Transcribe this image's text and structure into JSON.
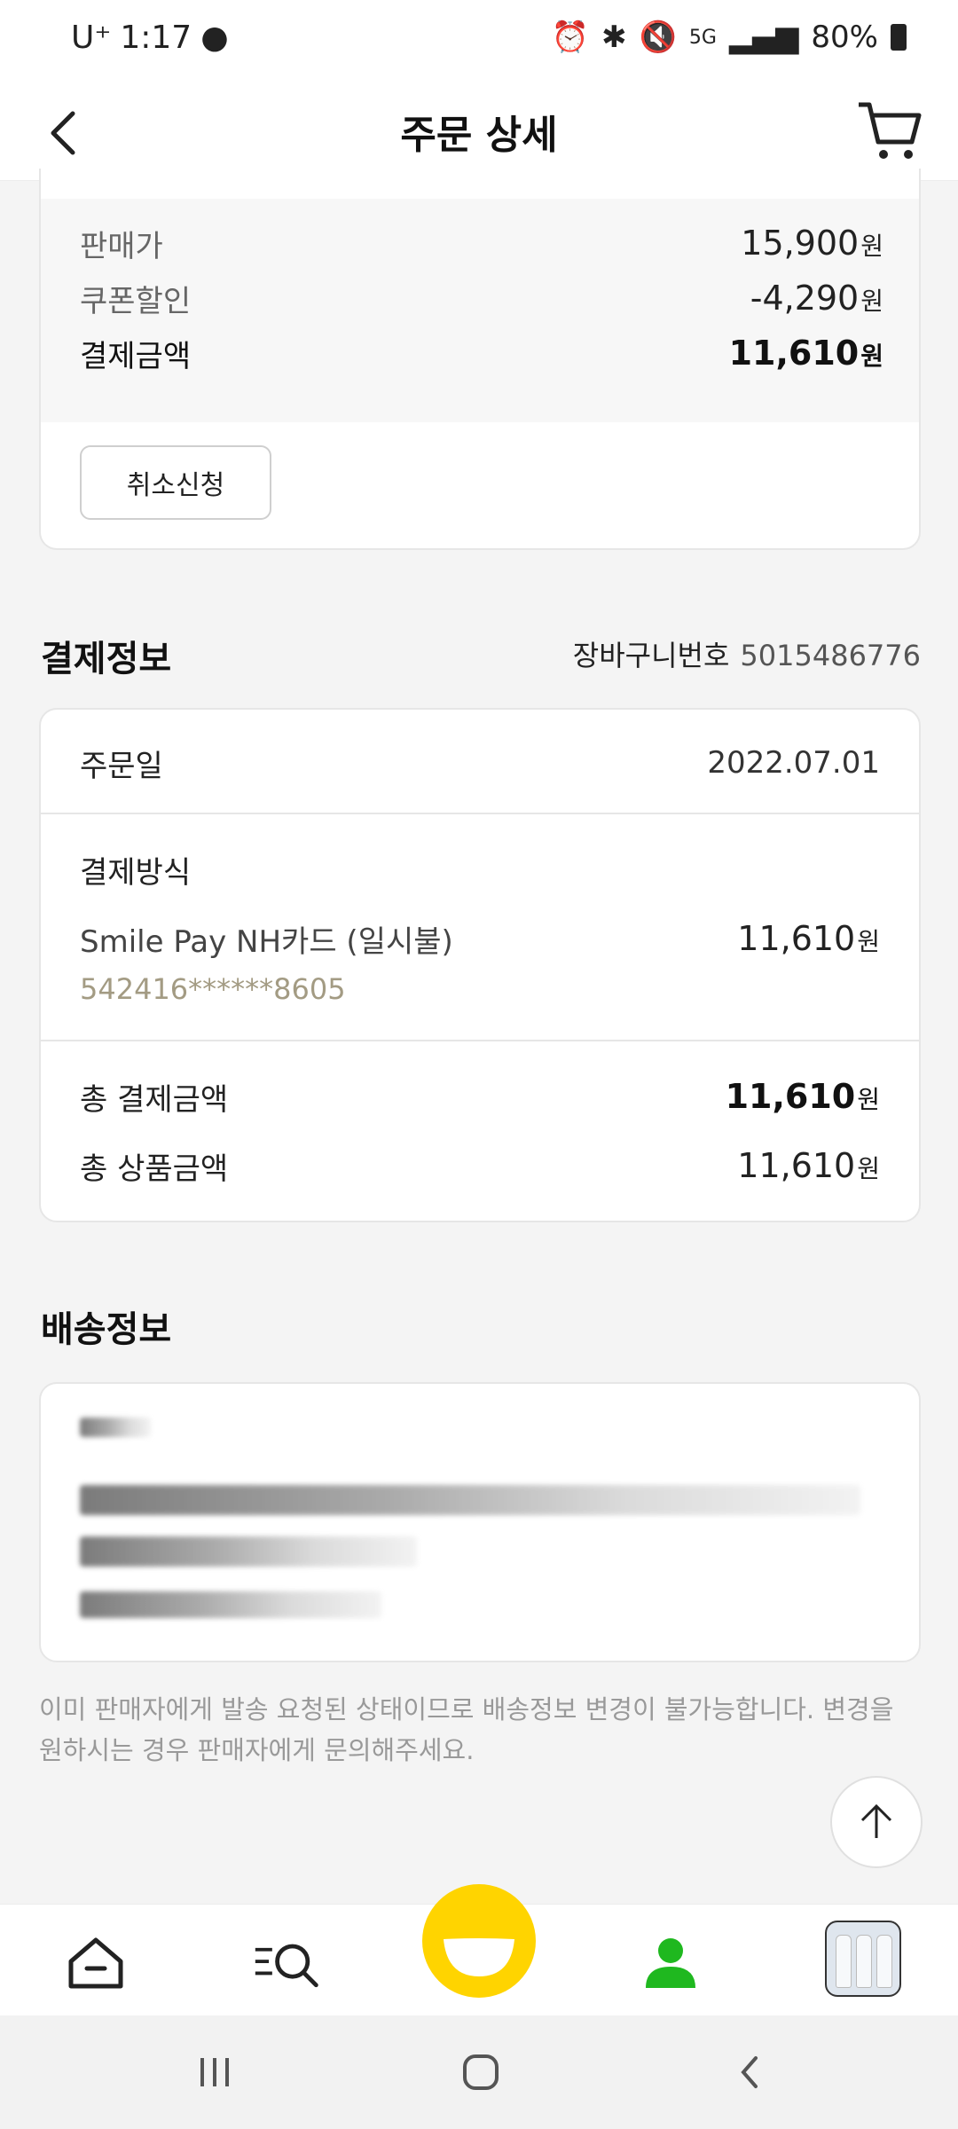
{
  "status_bar": {
    "carrier": "U⁺",
    "time": "1:17",
    "network": "5G",
    "battery": "80%"
  },
  "header": {
    "title": "주문 상세"
  },
  "price": {
    "rows": [
      {
        "label": "판매가",
        "value": "15,900",
        "unit": "원"
      },
      {
        "label": "쿠폰할인",
        "value": "-4,290",
        "unit": "원"
      },
      {
        "label": "결제금액",
        "value": "11,610",
        "unit": "원"
      }
    ],
    "cancel_label": "취소신청"
  },
  "payment": {
    "title": "결제정보",
    "cart_label": "장바구니번호",
    "cart_number": "5015486776",
    "order_date_label": "주문일",
    "order_date": "2022.07.01",
    "method_label": "결제방식",
    "method_name": "Smile Pay NH카드 (일시불)",
    "method_amount": "11,610",
    "card_number": "542416******8605",
    "total_pay_label": "총 결제금액",
    "total_pay": "11,610",
    "total_goods_label": "총 상품금액",
    "total_goods": "11,610",
    "unit": "원"
  },
  "shipping": {
    "title": "배송정보",
    "notice": "이미 판매자에게 발송 요청된 상태이므로 배송정보 변경이 불가능합니다. 변경을 원하시는 경우 판매자에게 문의해주세요."
  },
  "colors": {
    "accent_yellow": "#ffd400",
    "accent_green": "#1fb81f",
    "card_number_gray": "#a39b83"
  }
}
